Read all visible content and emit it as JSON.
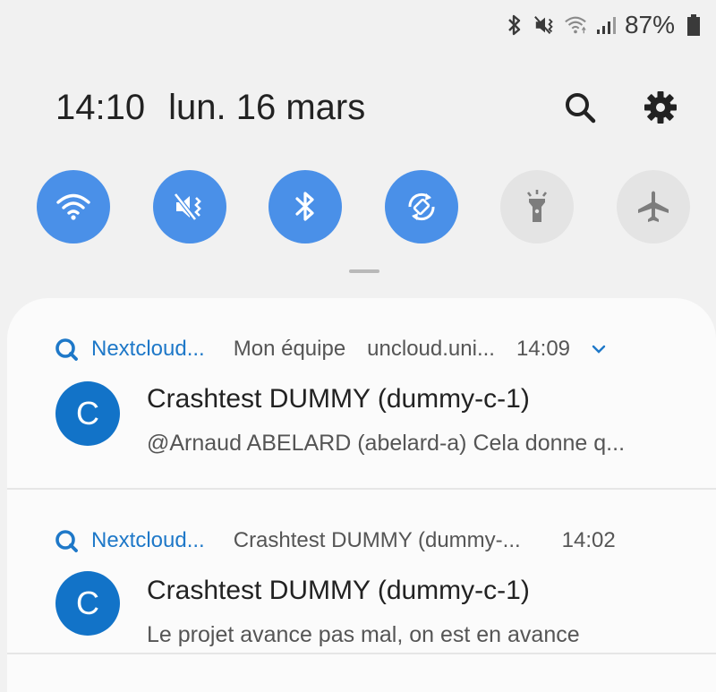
{
  "status_bar": {
    "icons": [
      "bluetooth-icon",
      "vibrate-icon",
      "wifi-icon",
      "signal-icon"
    ],
    "battery_percent": "87%"
  },
  "header": {
    "time": "14:10",
    "date": "lun. 16 mars",
    "search_icon": "search-icon",
    "settings_icon": "gear-icon"
  },
  "quick_settings": [
    {
      "name": "wifi",
      "icon": "wifi-icon",
      "state": "on"
    },
    {
      "name": "vibrate",
      "icon": "vibrate-icon",
      "state": "on"
    },
    {
      "name": "bluetooth",
      "icon": "bluetooth-icon",
      "state": "on"
    },
    {
      "name": "auto-rotate",
      "icon": "rotate-icon",
      "state": "on"
    },
    {
      "name": "flashlight",
      "icon": "flashlight-icon",
      "state": "off"
    },
    {
      "name": "airplane-mode",
      "icon": "airplane-icon",
      "state": "off"
    }
  ],
  "notifications": [
    {
      "app_name": "Nextcloud...",
      "meta": [
        "Mon équipe",
        "uncloud.uni..."
      ],
      "time": "14:09",
      "avatar_letter": "C",
      "title": "Crashtest DUMMY (dummy-c-1)",
      "body": "@Arnaud ABELARD (abelard-a) Cela donne q..."
    },
    {
      "app_name": "Nextcloud...",
      "meta": [
        "Crashtest DUMMY (dummy-..."
      ],
      "time": "14:02",
      "avatar_letter": "C",
      "title": "Crashtest DUMMY (dummy-c-1)",
      "body": "Le projet avance pas mal, on est en avance"
    }
  ],
  "colors": {
    "accent": "#4a90e8",
    "tile_off": "#e4e4e4",
    "nextcloud_blue": "#1e78c8",
    "avatar": "#1273c8",
    "background": "#f1f1f1"
  }
}
